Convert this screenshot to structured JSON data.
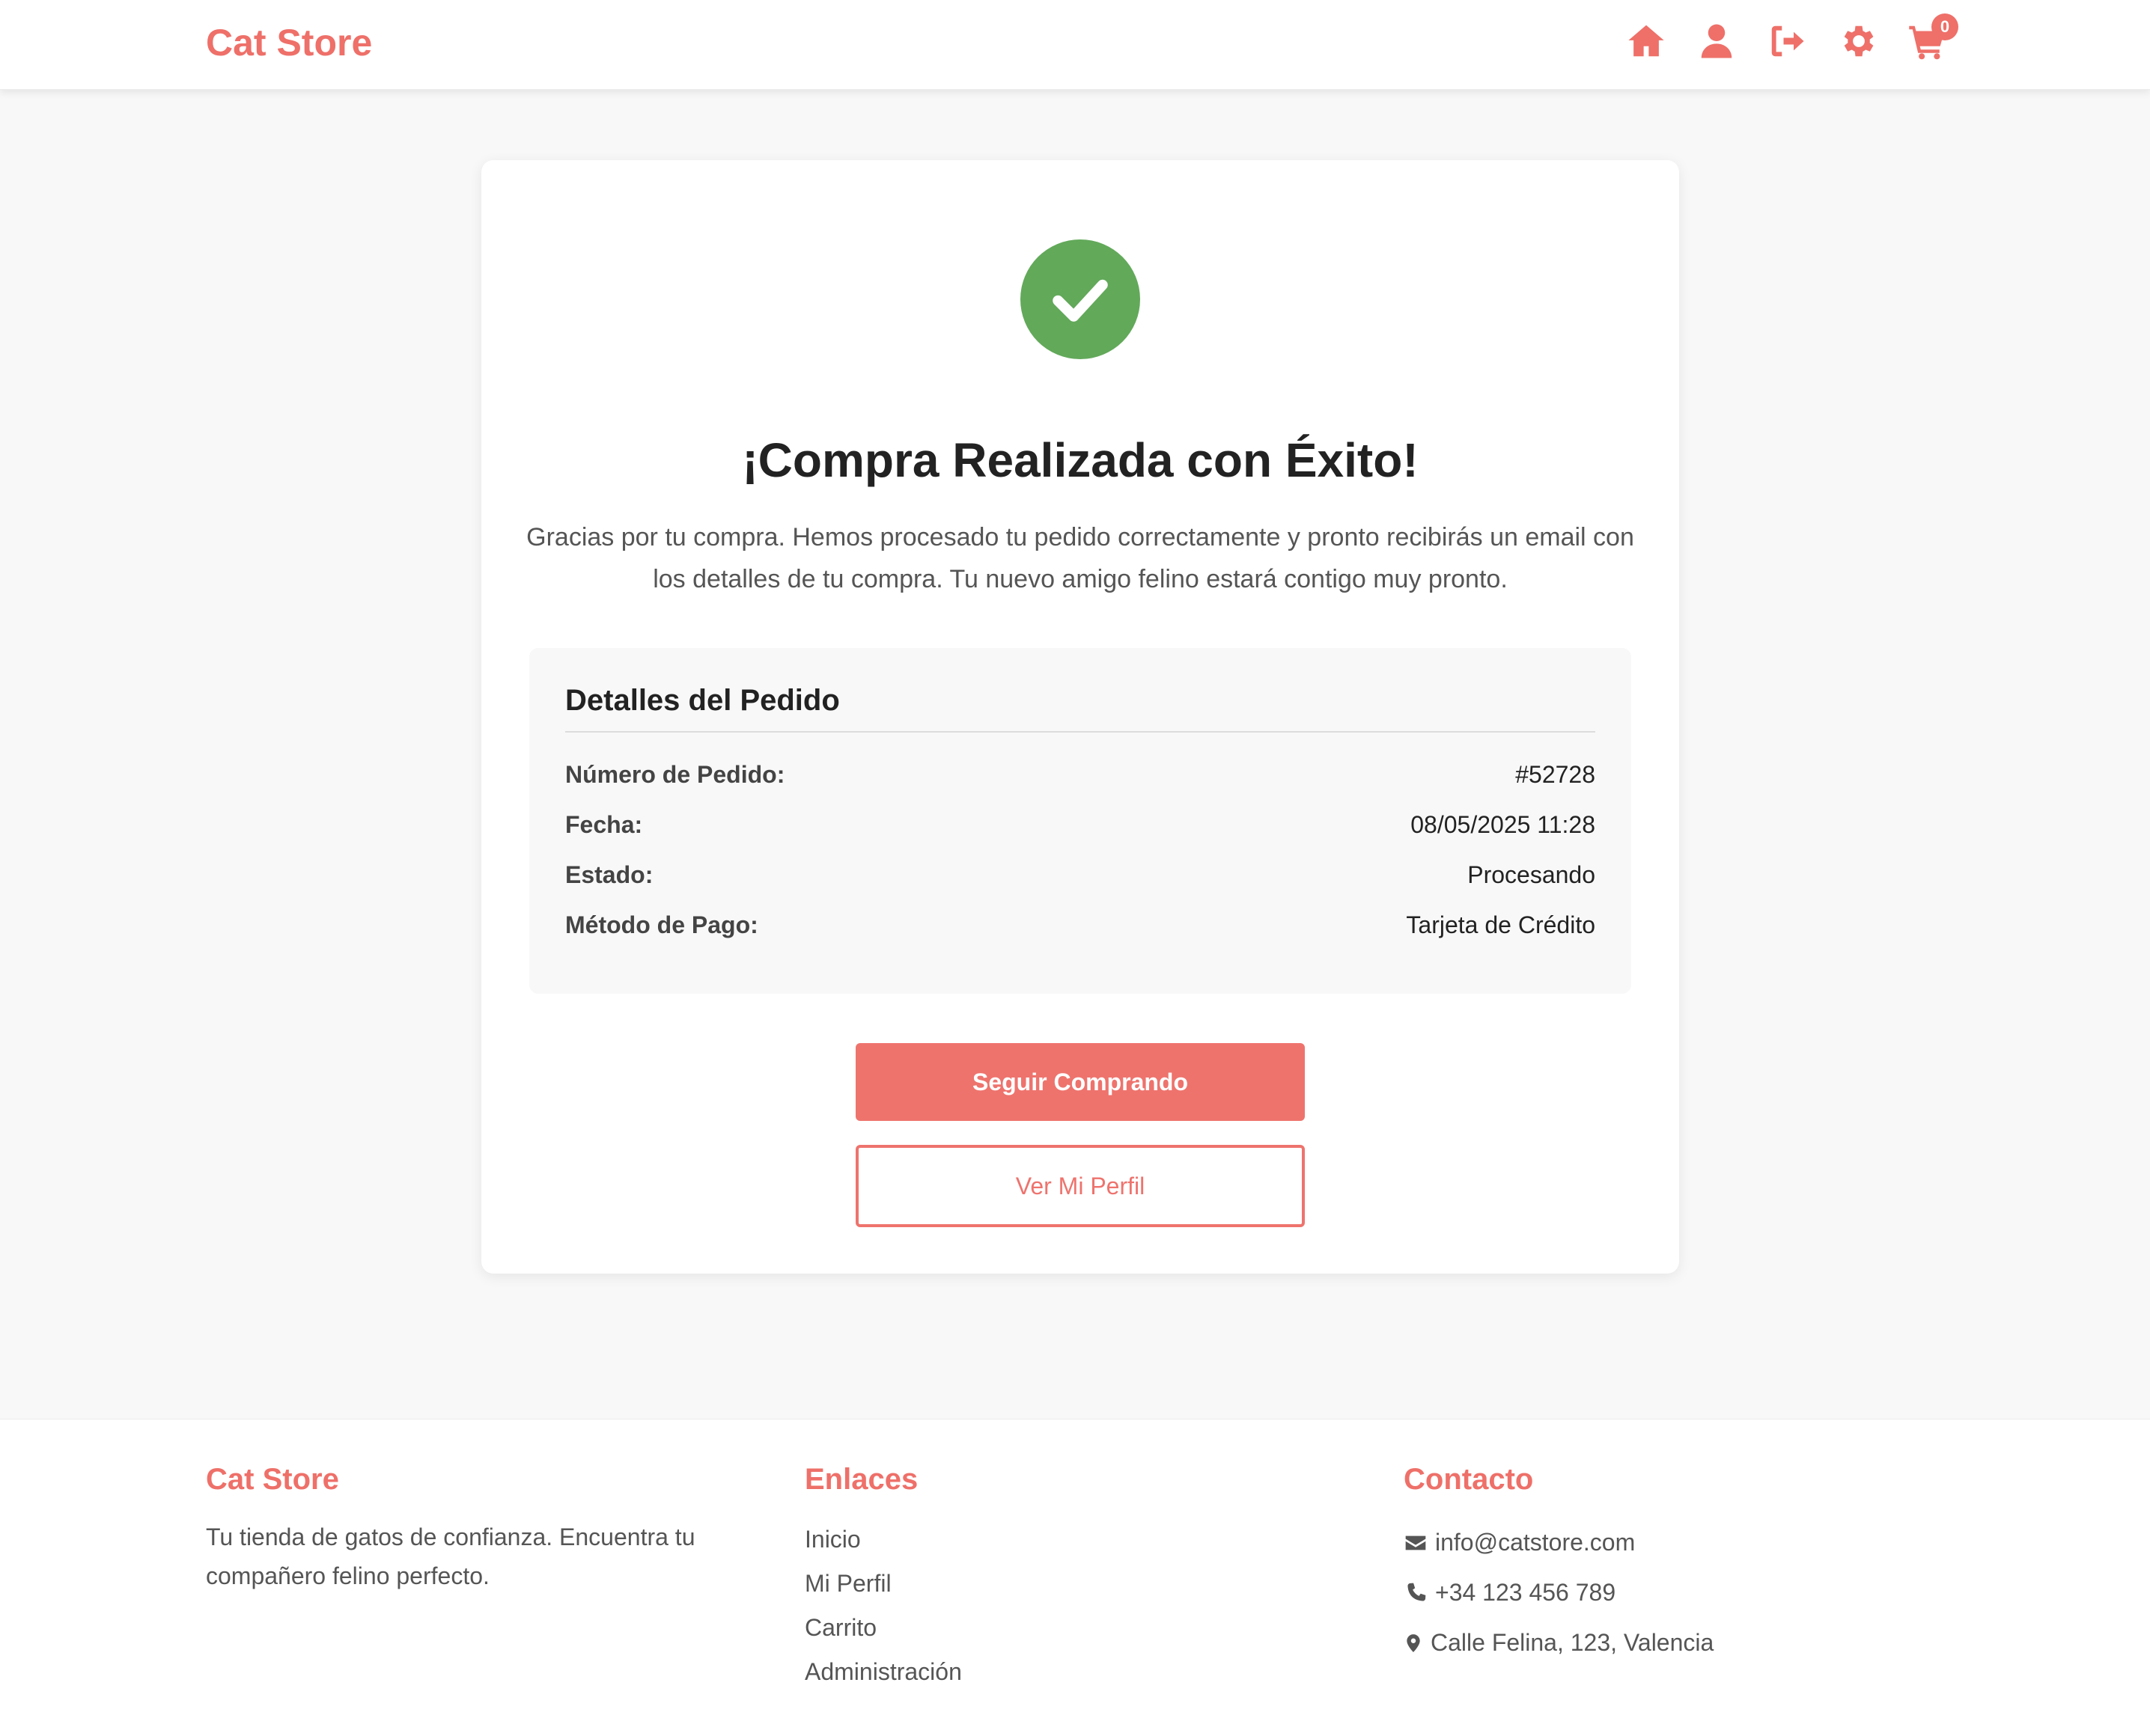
{
  "header": {
    "brand": "Cat Store",
    "nav_icons": [
      "home-icon",
      "user-icon",
      "logout-icon",
      "gear-icon",
      "cart-icon"
    ],
    "cart_count": "0"
  },
  "success": {
    "icon": "check-circle-icon",
    "title": "¡Compra Realizada con Éxito!",
    "message": "Gracias por tu compra. Hemos procesado tu pedido correctamente y pronto recibirás un email con los detalles de tu compra. Tu nuevo amigo felino estará contigo muy pronto."
  },
  "order_details": {
    "title": "Detalles del Pedido",
    "rows": [
      {
        "label": "Número de Pedido:",
        "value": "#52728"
      },
      {
        "label": "Fecha:",
        "value": "08/05/2025 11:28"
      },
      {
        "label": "Estado:",
        "value": "Procesando"
      },
      {
        "label": "Método de Pago:",
        "value": "Tarjeta de Crédito"
      }
    ]
  },
  "actions": {
    "continue_label": "Seguir Comprando",
    "profile_label": "Ver Mi Perfil"
  },
  "footer": {
    "about": {
      "title": "Cat Store",
      "text": "Tu tienda de gatos de confianza. Encuentra tu compañero felino perfecto."
    },
    "links": {
      "title": "Enlaces",
      "items": [
        "Inicio",
        "Mi Perfil",
        "Carrito",
        "Administración"
      ]
    },
    "contact": {
      "title": "Contacto",
      "email": "info@catstore.com",
      "phone": "+34 123 456 789",
      "address": "Calle Felina, 123, Valencia"
    }
  },
  "colors": {
    "accent": "#ee7069",
    "success": "#62a95a",
    "background": "#f8f8f8"
  }
}
